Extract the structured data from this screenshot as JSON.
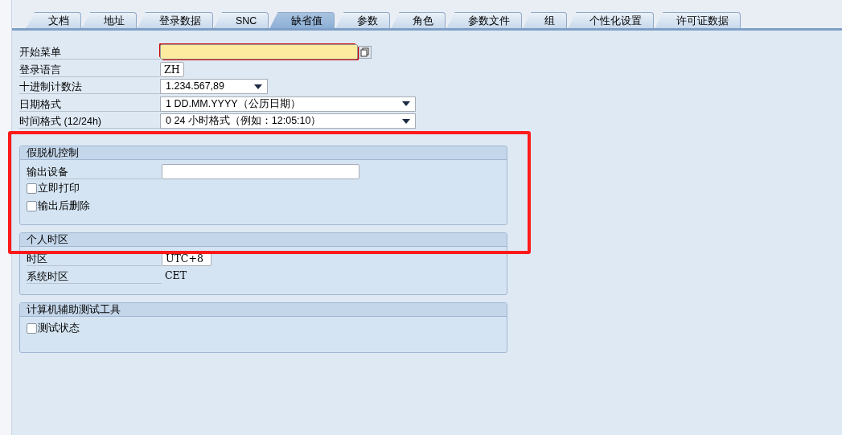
{
  "tabs": [
    {
      "label": "文档",
      "selected": false
    },
    {
      "label": "地址",
      "selected": false
    },
    {
      "label": "登录数据",
      "selected": false
    },
    {
      "label": "SNC",
      "selected": false
    },
    {
      "label": "缺省值",
      "selected": true
    },
    {
      "label": "参数",
      "selected": false
    },
    {
      "label": "角色",
      "selected": false
    },
    {
      "label": "参数文件",
      "selected": false
    },
    {
      "label": "组",
      "selected": false
    },
    {
      "label": "个性化设置",
      "selected": false
    },
    {
      "label": "许可证数据",
      "selected": false
    }
  ],
  "fields": [
    {
      "kind": "input",
      "label": "开始菜单",
      "focused": true,
      "value_help": true
    },
    {
      "kind": "input",
      "label": "登录语言",
      "value": "ZH",
      "focused": false
    },
    {
      "kind": "dropdown",
      "label": "十进制计数法",
      "value": "1.234.567,89"
    },
    {
      "kind": "dropdown",
      "label": "日期格式",
      "value": "1 DD.MM.YYYY（公历日期）"
    },
    {
      "kind": "dropdown",
      "label": "时间格式 (12/24h)",
      "value": "0 24 小时格式（例如：12:05:10）"
    }
  ],
  "groups": [
    {
      "title": "假脱机控制",
      "highlighted": true,
      "rows": [
        {
          "kind": "input",
          "label": "输出设备"
        },
        {
          "kind": "checkbox",
          "label": "立即打印",
          "checked": false
        },
        {
          "kind": "checkbox",
          "label": "输出后删除",
          "checked": false
        }
      ]
    },
    {
      "title": "个人时区",
      "highlighted": true,
      "rows": [
        {
          "kind": "input",
          "label": "时区",
          "value": "UTC+8"
        },
        {
          "kind": "text",
          "label": "系统时区",
          "value": "CET"
        }
      ]
    },
    {
      "title": "计算机辅助测试工具",
      "highlighted": false,
      "rows": [
        {
          "kind": "checkbox",
          "label": "测试状态",
          "checked": false
        }
      ]
    }
  ]
}
